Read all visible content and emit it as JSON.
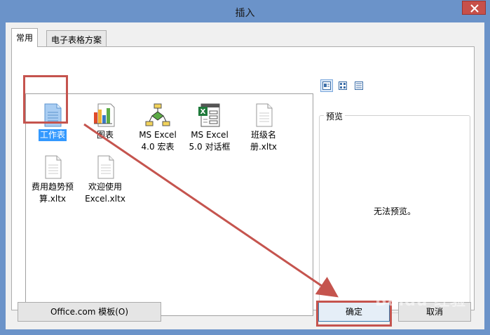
{
  "window": {
    "title": "插入"
  },
  "tabs": [
    {
      "label": "常用",
      "active": true
    },
    {
      "label": "电子表格方案",
      "active": false
    }
  ],
  "view_buttons": [
    "large-icons-icon",
    "list-icon",
    "details-icon"
  ],
  "files": [
    {
      "label": "工作表",
      "icon": "worksheet-icon",
      "selected": true
    },
    {
      "label": "图表",
      "icon": "chart-icon",
      "selected": false
    },
    {
      "label": "MS Excel 4.0 宏表",
      "icon": "macro-sheet-icon",
      "selected": false
    },
    {
      "label": "MS Excel 5.0 对话框",
      "icon": "dialog-sheet-icon",
      "selected": false
    },
    {
      "label": "班级名册.xltx",
      "icon": "template-file-icon",
      "selected": false
    },
    {
      "label": "费用趋势预算.xltx",
      "icon": "template-file-icon",
      "selected": false
    },
    {
      "label": "欢迎使用Excel.xltx",
      "icon": "template-file-icon",
      "selected": false
    }
  ],
  "preview": {
    "legend": "预览",
    "message": "无法预览。"
  },
  "buttons": {
    "office_templates": "Office.com 模板(O)",
    "ok": "确定",
    "cancel": "取消"
  },
  "annotation": {
    "color": "#c5544e"
  },
  "watermark": "Baidu 经验"
}
